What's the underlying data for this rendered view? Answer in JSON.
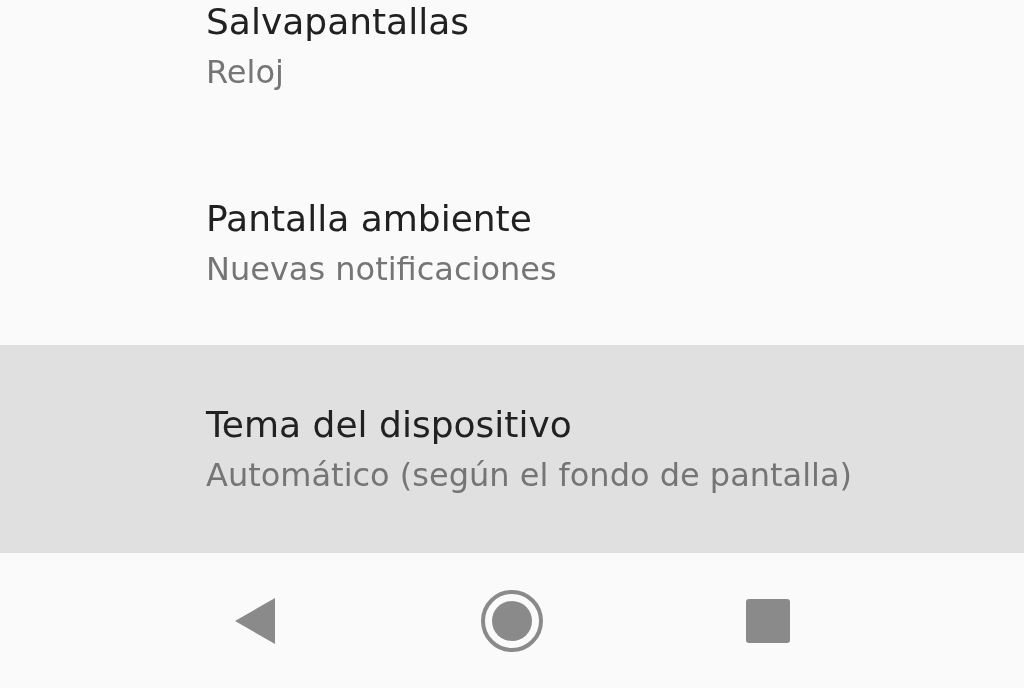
{
  "settings": [
    {
      "title": "Salvapantallas",
      "summary": "Reloj",
      "selected": false
    },
    {
      "title": "Pantalla ambiente",
      "summary": "Nuevas notificaciones",
      "selected": false
    },
    {
      "title": "Tema del dispositivo",
      "summary": "Automático (según el fondo de pantalla)",
      "selected": true
    }
  ]
}
